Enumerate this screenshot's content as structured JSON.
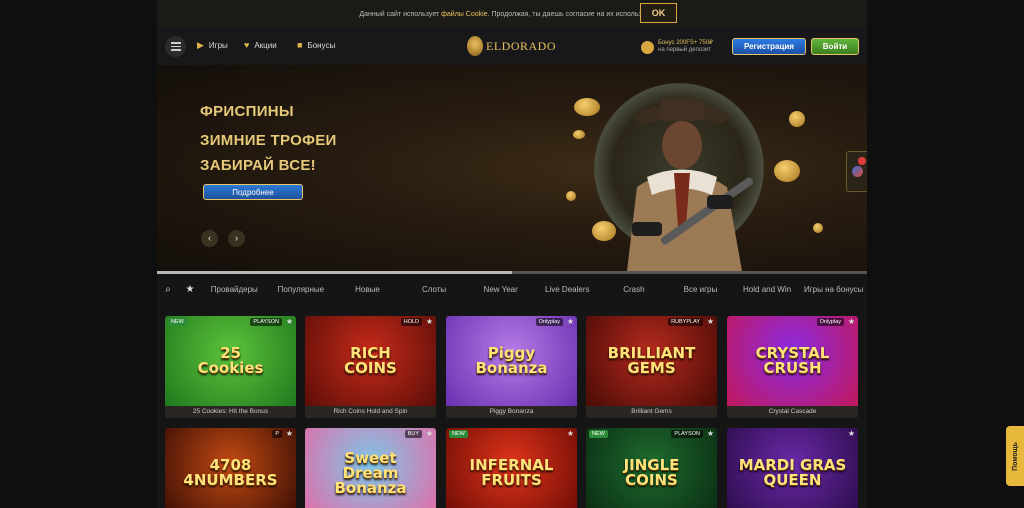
{
  "cookie": {
    "text_before": "Данный сайт использует",
    "link": "файлы Cookie",
    "text_after": ". Продолжая, ты даешь согласие на их использование",
    "ok": "OK"
  },
  "header": {
    "nav": [
      {
        "label": "Игры",
        "icon": "play-icon"
      },
      {
        "label": "Акции",
        "icon": "heart-icon"
      },
      {
        "label": "Бонусы",
        "icon": "gift-icon"
      }
    ],
    "logo": "ELDORADO",
    "bonus_line1": "Бонус 200FS+ 750₽",
    "bonus_line2": "на первый депозит",
    "register": "Регистрация",
    "login": "Войти"
  },
  "hero": {
    "line1": "ФРИСПИНЫ",
    "line2": "ЗИМНИЕ ТРОФЕИ",
    "line3": "ЗАБИРАЙ ВСЕ!",
    "button": "Подробнее",
    "slide_progress": 0.5
  },
  "tabs": [
    "Провайдеры",
    "Популярные",
    "Новые",
    "Слоты",
    "New Year",
    "Live Dealers",
    "Crash",
    "Все игры",
    "Hold and Win",
    "Игры на бонусы"
  ],
  "games": [
    {
      "name": "25 Cookies: Hit the Bonus",
      "art": "25\nCookies",
      "tag": "NEW",
      "provider": "PLAYSON",
      "c1": "#5cc23a",
      "c2": "#1f7a1e"
    },
    {
      "name": "Rich Coins Hold and Spin",
      "art": "RICH\nCOINS",
      "tag": "",
      "provider": "HOLD",
      "c1": "#c62a1a",
      "c2": "#5c0e08"
    },
    {
      "name": "Piggy Bonanza",
      "art": "Piggy\nBonanza",
      "tag": "",
      "provider": "Onlyplay",
      "c1": "#b67be6",
      "c2": "#6a2fb0"
    },
    {
      "name": "Brilliant Gems",
      "art": "BRILLIANT\nGEMS",
      "tag": "",
      "provider": "RUBYPLAY",
      "c1": "#b52a1e",
      "c2": "#4a0b06"
    },
    {
      "name": "Crystal Cascade",
      "art": "CRYSTAL\nCRUSH",
      "tag": "",
      "provider": "Onlyplay",
      "c1": "#8a2be2",
      "c2": "#c2185b"
    },
    {
      "name": "",
      "art": "4708\n4NUMBERS",
      "tag": "",
      "provider": "P",
      "c1": "#c24a12",
      "c2": "#3a0d05"
    },
    {
      "name": "",
      "art": "Sweet\nDream\nBonanza",
      "tag": "",
      "provider": "BUY",
      "c1": "#7fc6e8",
      "c2": "#e36aa6"
    },
    {
      "name": "",
      "art": "INFERNAL\nFRUITS",
      "tag": "NEW",
      "provider": "",
      "c1": "#e0341a",
      "c2": "#6b0b05"
    },
    {
      "name": "",
      "art": "JINGLE\nCOINS",
      "tag": "NEW",
      "provider": "PLAYSON",
      "c1": "#1e6b2e",
      "c2": "#0a2b12"
    },
    {
      "name": "",
      "art": "MARDI GRAS\nQUEEN",
      "tag": "",
      "provider": "",
      "c1": "#6a2aa8",
      "c2": "#2a0b4a"
    }
  ],
  "help": "Помощь"
}
